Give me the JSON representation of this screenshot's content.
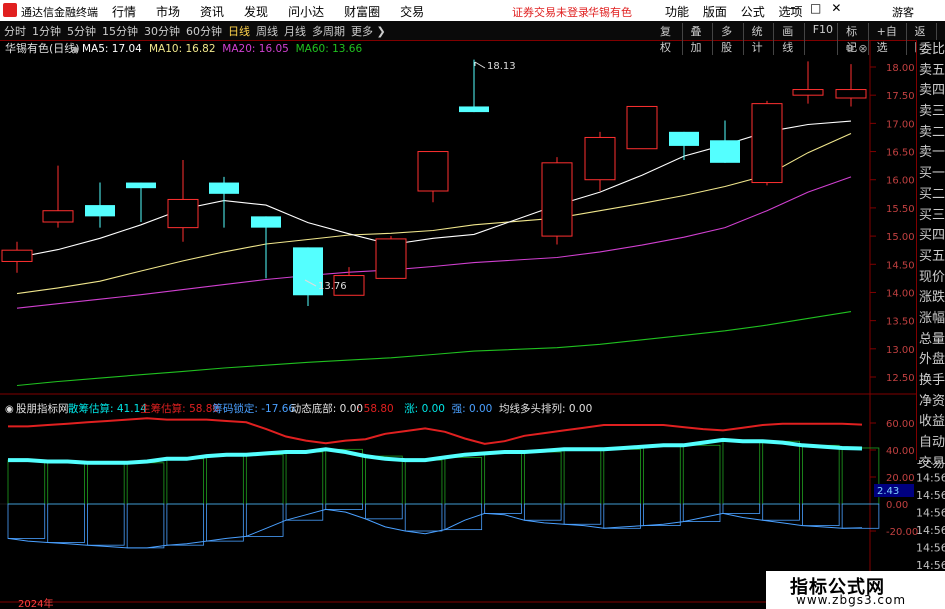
{
  "titlebar": {
    "app_name": "通达信金融终端",
    "menu": [
      "行情",
      "市场",
      "资讯",
      "发现",
      "问小达",
      "财富圈",
      "交易"
    ],
    "login_warning": "证券交易未登录",
    "stock_name": "华锡有色",
    "right_menu": [
      "功能",
      "版面",
      "公式",
      "选项"
    ],
    "window_controls": "—□✕",
    "guest": "游客"
  },
  "toolbar": {
    "periods": [
      "分时",
      "1分钟",
      "5分钟",
      "15分钟",
      "30分钟",
      "60分钟",
      "日线",
      "周线",
      "月线",
      "多周期",
      "更多 ❯"
    ],
    "active_period": "日线",
    "right_tools": [
      "复权",
      "叠加",
      "多股",
      "统计",
      "画线",
      "F10",
      "标记",
      "+自选",
      "返回"
    ]
  },
  "main_chart": {
    "title": "华锡有色(日线)",
    "ma_labels": [
      {
        "text": "MA5: 17.04",
        "color": "#ffffff"
      },
      {
        "text": "MA10: 16.82",
        "color": "#f0e68c"
      },
      {
        "text": "MA20: 16.05",
        "color": "#d040d0"
      },
      {
        "text": "MA60: 13.66",
        "color": "#20c020"
      }
    ],
    "high_label": "18.13",
    "low_label": "13.76"
  },
  "indicator": {
    "name": "股朋指标网",
    "values": [
      {
        "text": "散筹估算: 41.14",
        "color": "#00e5e5"
      },
      {
        "text": "主筹估算: 58.80",
        "color": "#e02020"
      },
      {
        "text": "筹码锁定: -17.66",
        "color": "#4aa0ff"
      },
      {
        "text": "动态底部: 0.00",
        "color": "#e0e0e0"
      },
      {
        "text": ": 58.80",
        "color": "#e02020"
      },
      {
        "text": "涨: 0.00",
        "color": "#00e5e5"
      },
      {
        "text": "强: 0.00",
        "color": "#4aa0ff"
      },
      {
        "text": "均线多头排列: 0.00",
        "color": "#e0e0e0"
      }
    ],
    "current_value_label": "2.43"
  },
  "right_panel": [
    "委比",
    "卖五",
    "卖四",
    "卖三",
    "卖二",
    "卖一",
    "买一",
    "买二",
    "买三",
    "买四",
    "买五",
    "现价",
    "涨跌",
    "涨幅",
    "总量",
    "外盘",
    "换手",
    "净资",
    "收益",
    "自动",
    "交易"
  ],
  "time_labels": [
    "14:56",
    "14:56",
    "14:56",
    "14:56",
    "14:56",
    "14:56",
    "14:56"
  ],
  "year_label": "2024年",
  "watermark": {
    "title": "指标公式网",
    "url": "www.zbgs3.com"
  },
  "colors": {
    "up": "#ff3030",
    "down": "#54ffff",
    "ma5": "#ffffff",
    "ma10": "#f0e68c",
    "ma20": "#d040d0",
    "ma60": "#20c020",
    "grid": "#800000"
  },
  "chart_data": [
    {
      "type": "candlestick",
      "title": "华锡有色(日线)",
      "y_ticks": [
        18.0,
        17.5,
        17.0,
        16.5,
        16.0,
        15.5,
        15.0,
        14.5,
        14.0,
        13.5,
        13.0,
        12.5
      ],
      "ylim": [
        12.2,
        18.45
      ],
      "candles": [
        {
          "o": 14.55,
          "c": 14.75,
          "h": 14.9,
          "l": 14.35
        },
        {
          "o": 15.25,
          "c": 15.45,
          "h": 16.25,
          "l": 15.15
        },
        {
          "o": 15.55,
          "c": 15.35,
          "h": 15.95,
          "l": 15.15
        },
        {
          "o": 15.95,
          "c": 15.85,
          "h": 15.95,
          "l": 15.25
        },
        {
          "o": 15.15,
          "c": 15.65,
          "h": 16.35,
          "l": 14.9
        },
        {
          "o": 15.95,
          "c": 15.75,
          "h": 16.05,
          "l": 15.15
        },
        {
          "o": 15.35,
          "c": 15.15,
          "h": 15.35,
          "l": 14.25
        },
        {
          "o": 14.8,
          "c": 13.95,
          "h": 14.8,
          "l": 13.76
        },
        {
          "o": 13.95,
          "c": 14.3,
          "h": 14.45,
          "l": 13.95
        },
        {
          "o": 14.25,
          "c": 14.95,
          "h": 15.0,
          "l": 14.25
        },
        {
          "o": 15.8,
          "c": 16.5,
          "h": 16.5,
          "l": 15.6
        },
        {
          "o": 17.3,
          "c": 17.2,
          "h": 18.13,
          "l": 17.2
        },
        {
          "o": 15.0,
          "c": 16.3,
          "h": 16.4,
          "l": 14.85
        },
        {
          "o": 16.0,
          "c": 16.75,
          "h": 16.85,
          "l": 15.8
        },
        {
          "o": 16.55,
          "c": 17.3,
          "h": 17.3,
          "l": 16.55
        },
        {
          "o": 16.85,
          "c": 16.6,
          "h": 16.85,
          "l": 16.35
        },
        {
          "o": 16.7,
          "c": 16.3,
          "h": 17.05,
          "l": 16.3
        },
        {
          "o": 15.95,
          "c": 17.35,
          "h": 17.4,
          "l": 15.9
        },
        {
          "o": 17.5,
          "c": 17.6,
          "h": 18.1,
          "l": 17.35
        },
        {
          "o": 17.45,
          "c": 17.6,
          "h": 18.05,
          "l": 17.3
        }
      ],
      "ma5": [
        14.62,
        14.76,
        14.96,
        15.2,
        15.48,
        15.63,
        15.55,
        15.24,
        15.04,
        14.85,
        14.96,
        15.03,
        15.55,
        15.78,
        16.08,
        16.42,
        16.62,
        16.85,
        16.98,
        17.04
      ],
      "ma10": [
        13.98,
        14.08,
        14.2,
        14.38,
        14.56,
        14.72,
        14.86,
        14.94,
        15.02,
        15.05,
        15.1,
        15.2,
        15.32,
        15.45,
        15.58,
        15.72,
        15.88,
        16.08,
        16.48,
        16.82
      ],
      "ma20": [
        13.72,
        13.8,
        13.88,
        13.96,
        14.05,
        14.14,
        14.23,
        14.3,
        14.36,
        14.4,
        14.46,
        14.53,
        14.62,
        14.72,
        14.84,
        14.98,
        15.15,
        15.45,
        15.78,
        16.05
      ],
      "ma60": [
        12.35,
        12.42,
        12.48,
        12.54,
        12.6,
        12.66,
        12.71,
        12.76,
        12.8,
        12.84,
        12.9,
        12.96,
        13.02,
        13.08,
        13.16,
        13.24,
        13.32,
        13.42,
        13.54,
        13.66
      ]
    },
    {
      "type": "bar",
      "title": "股朋指标网",
      "y_ticks": [
        60.0,
        40.0,
        20.0,
        0.0,
        -20.0
      ],
      "ylim": [
        -21,
        65
      ],
      "series": [
        {
          "name": "散筹估算",
          "values": [
            32.5,
            32.5,
            31.5,
            31.5,
            30.5,
            30.5,
            30.5,
            31.5,
            33.5,
            33.5,
            35.5,
            36.5,
            36.5,
            37.5,
            38.5,
            38.5,
            40.5,
            38.5,
            35.5,
            33.5,
            32.5,
            32.5,
            34.5,
            36.5,
            37.5,
            38.5,
            38.5,
            39.5,
            40.5,
            40.5,
            40.5,
            41.5,
            42.5,
            43.5,
            43.5,
            45.5,
            47.5,
            46.5,
            46.5,
            45.5,
            43.5,
            42.5,
            41.5,
            41.14
          ]
        },
        {
          "name": "主筹估算",
          "values": [
            57.5,
            57.5,
            58.5,
            59.5,
            60.5,
            61.5,
            62.5,
            63.5,
            62.5,
            62.5,
            62.5,
            61.5,
            60.5,
            55.5,
            50.0,
            47.0,
            45.0,
            47.0,
            48.0,
            52.0,
            54.0,
            56.0,
            53.5,
            48.5,
            44.5,
            46.5,
            50.5,
            52.5,
            54.5,
            56.5,
            58.5,
            58.5,
            58.5,
            58.5,
            57.0,
            55.5,
            54.5,
            56.5,
            58.5,
            59.5,
            59.5,
            59.5,
            59.5,
            58.8
          ]
        },
        {
          "name": "筹码锁定",
          "values": [
            -25.5,
            -27.5,
            -28.5,
            -29.5,
            -30.5,
            -31.5,
            -32.5,
            -32.5,
            -30.5,
            -29.5,
            -27.5,
            -25.5,
            -24.0,
            -18.0,
            -12.0,
            -8.0,
            -4.0,
            -6.0,
            -11.0,
            -17.0,
            -20.0,
            -22.0,
            -19.0,
            -12.0,
            -7.0,
            -8.0,
            -12.0,
            -14.0,
            -15.0,
            -16.0,
            -18.0,
            -17.0,
            -16.0,
            -15.0,
            -13.0,
            -10.0,
            -7.0,
            -10.0,
            -12.0,
            -14.0,
            -16.0,
            -17.0,
            -18.0,
            -17.66
          ]
        }
      ]
    }
  ]
}
